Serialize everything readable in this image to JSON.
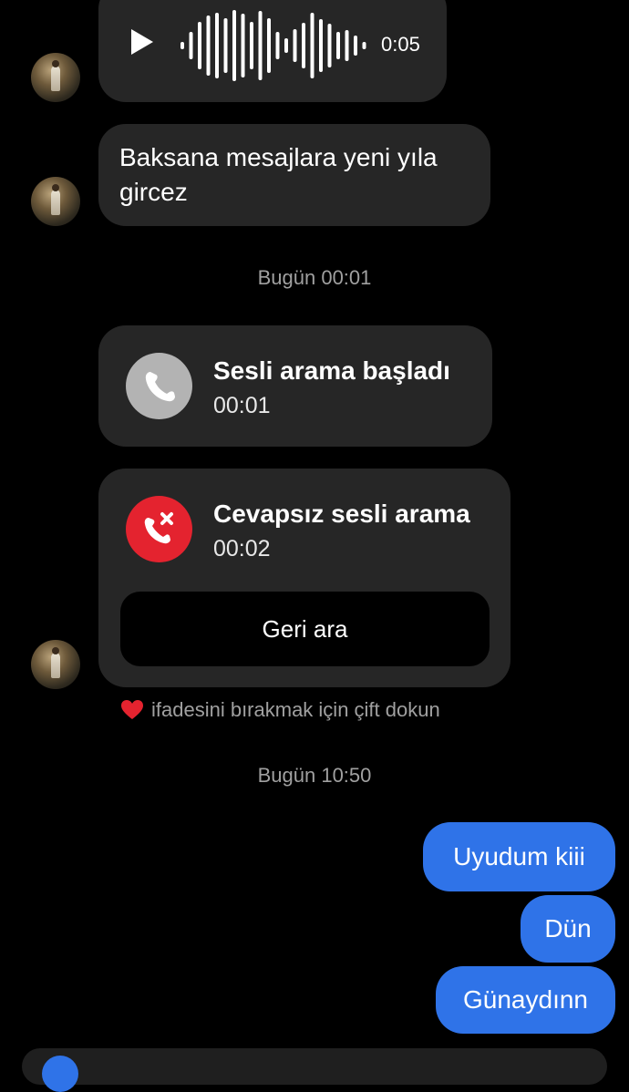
{
  "voice_message": {
    "duration": "0:05"
  },
  "messages_in": {
    "text1": "Baksana mesajlara yeni yıla gircez"
  },
  "timestamps": {
    "first": "Bugün 00:01",
    "second": "Bugün 10:50"
  },
  "call_started": {
    "title": "Sesli arama başladı",
    "time": "00:01"
  },
  "missed_call": {
    "title": "Cevapsız sesli arama",
    "time": "00:02",
    "callback_label": "Geri ara"
  },
  "reaction_hint": {
    "text": "ifadesini bırakmak için çift dokun"
  },
  "messages_out": [
    "Uyudum kiii",
    "Dün",
    "Günaydınn"
  ],
  "colors": {
    "incoming_bubble": "#262626",
    "outgoing_bubble": "#2f73e8",
    "missed_call_red": "#e4232f",
    "call_gray": "#b3b3b3",
    "background": "#000000"
  }
}
